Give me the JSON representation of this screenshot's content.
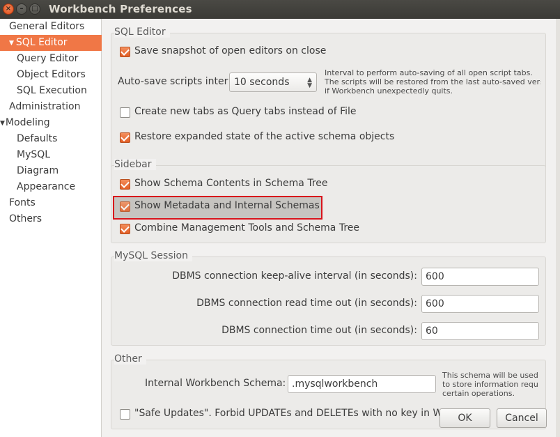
{
  "window": {
    "title": "Workbench Preferences",
    "close_glyph": "×",
    "min_glyph": "–",
    "max_glyph": "□"
  },
  "sidebar": {
    "items": [
      {
        "label": "General Editors",
        "level": 0
      },
      {
        "label": "SQL Editor",
        "level": 0,
        "selected": true,
        "expanded": true
      },
      {
        "label": "Query Editor",
        "level": 1
      },
      {
        "label": "Object Editors",
        "level": 1
      },
      {
        "label": "SQL Execution",
        "level": 1
      },
      {
        "label": "Administration",
        "level": 0
      },
      {
        "label": "Modeling",
        "level": 0,
        "expanded": true
      },
      {
        "label": "Defaults",
        "level": 1
      },
      {
        "label": "MySQL",
        "level": 1
      },
      {
        "label": "Diagram",
        "level": 1
      },
      {
        "label": "Appearance",
        "level": 1
      },
      {
        "label": "Fonts",
        "level": 0
      },
      {
        "label": "Others",
        "level": 0
      }
    ]
  },
  "sql_editor": {
    "heading": "SQL Editor",
    "save_snapshot": {
      "label": "Save snapshot of open editors on close",
      "checked": true
    },
    "auto_save": {
      "label": "Auto-save scripts inter",
      "value": "10 seconds",
      "help": [
        "Interval to perform auto-saving of all open script tabs.",
        "The scripts will be restored from the last auto-saved vers",
        "if Workbench unexpectedly quits."
      ]
    },
    "new_tabs": {
      "label": "Create new tabs as Query tabs instead of File",
      "checked": false
    },
    "restore_state": {
      "label": "Restore expanded state of the active schema objects",
      "checked": true
    }
  },
  "sidebar_group": {
    "heading": "Sidebar",
    "schema_contents": {
      "label": "Show Schema Contents in Schema Tree",
      "checked": true
    },
    "metadata": {
      "label": "Show Metadata and Internal Schemas",
      "checked": true,
      "highlighted": true
    },
    "combine_tools": {
      "label": "Combine Management Tools and Schema Tree",
      "checked": true
    }
  },
  "mysql_session": {
    "heading": "MySQL Session",
    "keep_alive": {
      "label": "DBMS connection keep-alive interval (in seconds):",
      "value": "600"
    },
    "read_timeout": {
      "label": "DBMS connection read time out (in seconds):",
      "value": "600"
    },
    "conn_timeout": {
      "label": "DBMS connection time out (in seconds):",
      "value": "60"
    }
  },
  "other": {
    "heading": "Other",
    "internal_schema": {
      "label": "Internal Workbench Schema:",
      "value": ".mysqlworkbench",
      "help": [
        "This schema will be used b",
        "to store information requ",
        "certain operations."
      ]
    },
    "safe_updates": {
      "label": "\"Safe Updates\". Forbid UPDATEs and DELETEs with no key in WH",
      "checked": false
    }
  },
  "buttons": {
    "ok": "OK",
    "cancel": "Cancel"
  },
  "colors": {
    "accent": "#f07746",
    "highlight_border": "#d8131b"
  }
}
